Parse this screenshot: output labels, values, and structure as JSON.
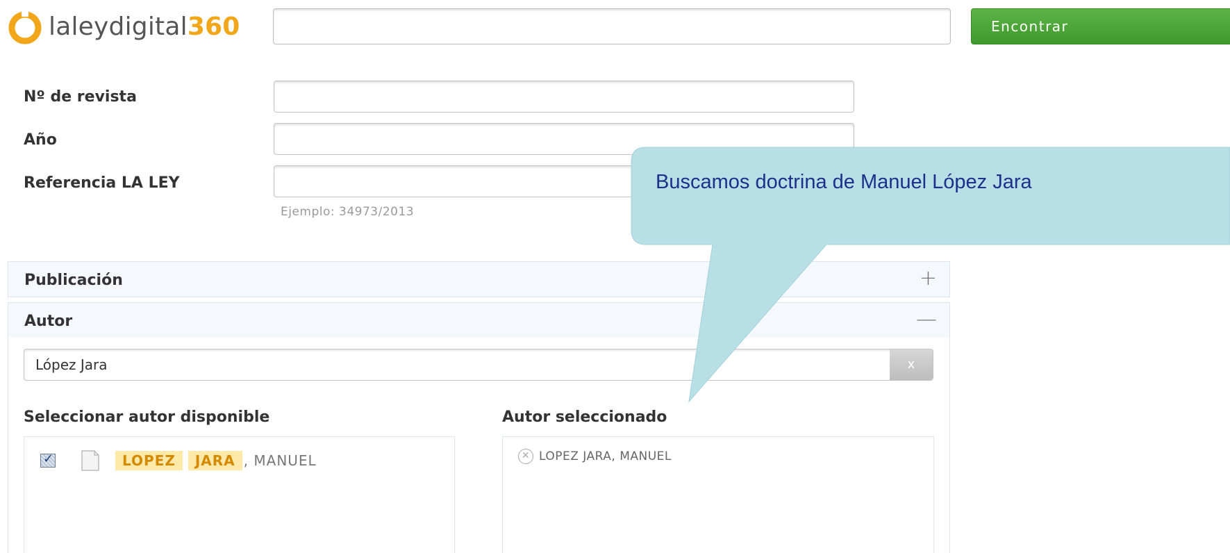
{
  "header": {
    "logo_text": "laleydigital",
    "logo_num": "360",
    "search_value": "",
    "find_label": "Encontrar"
  },
  "form": {
    "revista_label": "Nº de revista",
    "anio_label": "Año",
    "referencia_label": "Referencia LA LEY",
    "referencia_hint": "Ejemplo: 34973/2013"
  },
  "accordion": {
    "publicacion": {
      "title": "Publicación",
      "toggle": "+"
    },
    "autor": {
      "title": "Autor",
      "toggle": "—"
    }
  },
  "autor": {
    "search_value": "López Jara",
    "clear_label": "x",
    "available_title": "Seleccionar autor disponible",
    "selected_title": "Autor seleccionado",
    "available_items": [
      {
        "surname1": "LOPEZ",
        "surname2": "JARA",
        "rest": " , MANUEL",
        "checked": true
      }
    ],
    "selected_items": [
      {
        "name": "LOPEZ JARA, MANUEL"
      }
    ]
  },
  "callout": {
    "text": "Buscamos doctrina de Manuel López Jara",
    "fill": "#b7dfe5"
  },
  "colors": {
    "brand_orange": "#f2a71b",
    "button_green": "#4aa537"
  }
}
